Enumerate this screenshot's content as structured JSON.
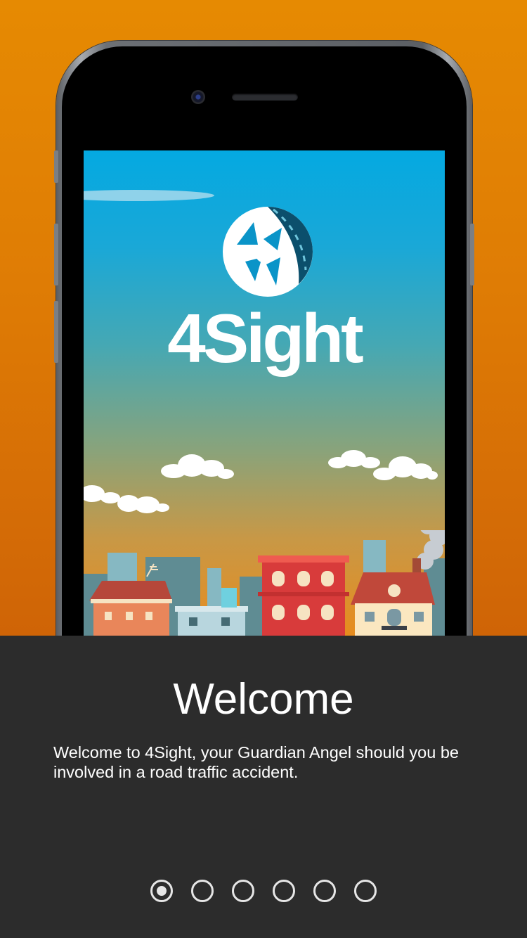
{
  "hero": {
    "brand_name": "4Sight",
    "logo_icon": "aperture-road-logo",
    "background_color": "#e68a02"
  },
  "welcome": {
    "title": "Welcome",
    "description": "Welcome to 4Sight, your Guardian Angel should you be involved in a road traffic accident."
  },
  "pagination": {
    "pages": [
      {
        "state": "active"
      },
      {
        "state": "inactive"
      },
      {
        "state": "inactive"
      },
      {
        "state": "inactive"
      },
      {
        "state": "inactive"
      },
      {
        "state": "inactive"
      }
    ],
    "active_color": "#e6e6e6"
  },
  "colors": {
    "panel": "#2c2c2c",
    "sky_top": "#04a9e1",
    "sky_bottom": "#e78c1e"
  }
}
